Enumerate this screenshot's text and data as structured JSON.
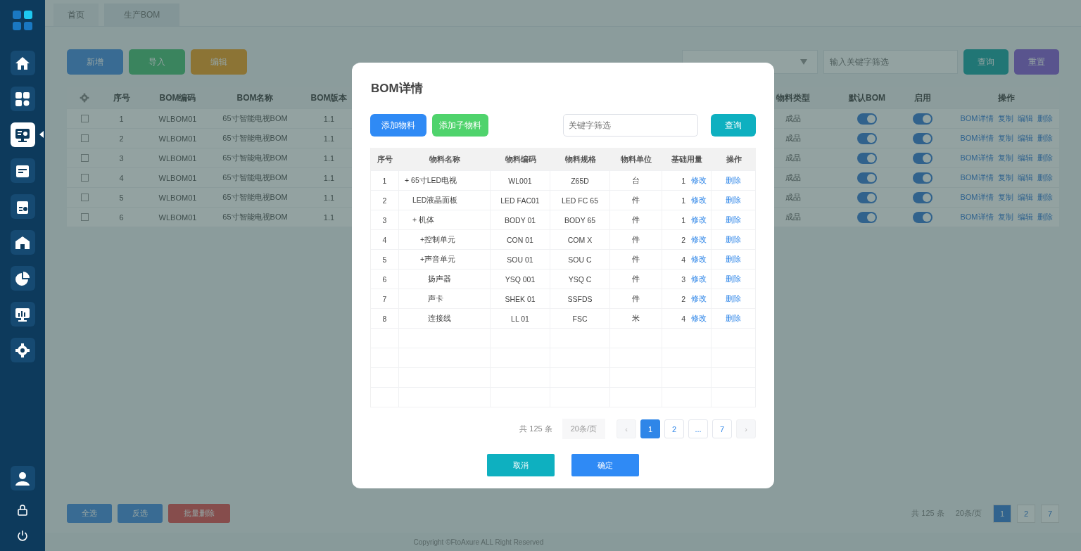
{
  "sidebar": {
    "items": [
      {
        "selected": false
      },
      {
        "selected": false
      },
      {
        "selected": true
      },
      {
        "selected": false
      },
      {
        "selected": false
      },
      {
        "selected": false
      },
      {
        "selected": false
      },
      {
        "selected": false
      },
      {
        "selected": false
      }
    ]
  },
  "tabs": [
    {
      "label": "首页",
      "selected": false
    },
    {
      "label": "生产BOM",
      "selected": true
    }
  ],
  "toolbar": {
    "buttons": [
      {
        "label": "新增",
        "kind": "blue"
      },
      {
        "label": "导入",
        "kind": "green"
      },
      {
        "label": "编辑",
        "kind": "orange"
      }
    ],
    "search_placeholder": "输入关键字筛选",
    "query": "查询",
    "reset": "重置"
  },
  "table": {
    "columns": [
      "序号",
      "BOM编码",
      "BOM名称",
      "BOM版本",
      "物料类型",
      "默认BOM",
      "启用",
      "操作"
    ],
    "rows": [
      {
        "checked": false,
        "no": "1",
        "code": "WLBOM01",
        "name": "65寸智能电视BOM",
        "version": "1.1",
        "type": "成品",
        "default_on": true,
        "enabled_on": true,
        "actions": [
          "BOM详情",
          "复制",
          "编辑",
          "删除"
        ]
      },
      {
        "checked": false,
        "no": "2",
        "code": "WLBOM01",
        "name": "65寸智能电视BOM",
        "version": "1.1",
        "type": "成品",
        "default_on": true,
        "enabled_on": true,
        "actions": [
          "BOM详情",
          "复制",
          "编辑",
          "删除"
        ]
      },
      {
        "checked": false,
        "no": "3",
        "code": "WLBOM01",
        "name": "65寸智能电视BOM",
        "version": "1.1",
        "type": "成品",
        "default_on": true,
        "enabled_on": true,
        "actions": [
          "BOM详情",
          "复制",
          "编辑",
          "删除"
        ]
      },
      {
        "checked": false,
        "no": "4",
        "code": "WLBOM01",
        "name": "65寸智能电视BOM",
        "version": "1.1",
        "type": "成品",
        "default_on": true,
        "enabled_on": true,
        "actions": [
          "BOM详情",
          "复制",
          "编辑",
          "删除"
        ]
      },
      {
        "checked": false,
        "no": "5",
        "code": "WLBOM01",
        "name": "65寸智能电视BOM",
        "version": "1.1",
        "type": "成品",
        "default_on": true,
        "enabled_on": true,
        "actions": [
          "BOM详情",
          "复制",
          "编辑",
          "删除"
        ]
      },
      {
        "checked": false,
        "no": "6",
        "code": "WLBOM01",
        "name": "65寸智能电视BOM",
        "version": "1.1",
        "type": "成品",
        "default_on": true,
        "enabled_on": true,
        "actions": [
          "BOM详情",
          "复制",
          "编辑",
          "删除"
        ]
      }
    ]
  },
  "bottom_buttons": [
    {
      "label": "全选",
      "kind": "blue"
    },
    {
      "label": "反选",
      "kind": "blue"
    },
    {
      "label": "批量删除",
      "kind": "red"
    }
  ],
  "pager": {
    "total": "共 125 条",
    "size": "20条/页",
    "pages": [
      {
        "label": "1",
        "selected": true
      },
      {
        "label": "2",
        "selected": false
      },
      {
        "label": "7",
        "selected": false
      }
    ]
  },
  "footer": "Copyright ©FtoAxure ALL Right Reserved",
  "modal": {
    "title": "BOM详情",
    "add": "添加物料",
    "add_child": "添加子物料",
    "search_placeholder": "关键字筛选",
    "query": "查询",
    "columns": [
      "序号",
      "物料名称",
      "物料编码",
      "物料规格",
      "物料单位",
      "基础用量",
      "操作"
    ],
    "rows": [
      {
        "no": "1",
        "name": "+ 65寸LED电视",
        "code": "WL001",
        "spec": "Z65D",
        "unit": "台",
        "qty": "1",
        "edit": "修改",
        "delete": "删除",
        "children": [
          {
            "no": "2",
            "name": "LED液晶面板",
            "code": "LED FAC01",
            "spec": "LED FC 65",
            "unit": "件",
            "qty": "1",
            "edit": "修改",
            "delete": "删除"
          },
          {
            "no": "3",
            "name": "+ 机体",
            "code": "BODY 01",
            "spec": "BODY 65",
            "unit": "件",
            "qty": "1",
            "edit": "修改",
            "delete": "删除",
            "children": [
              {
                "no": "4",
                "name": "+控制单元",
                "code": "CON 01",
                "spec": "COM X",
                "unit": "件",
                "qty": "2",
                "edit": "修改",
                "delete": "删除"
              },
              {
                "no": "5",
                "name": "+声音单元",
                "code": "SOU 01",
                "spec": "SOU C",
                "unit": "件",
                "qty": "4",
                "edit": "修改",
                "delete": "删除",
                "children": [
                  {
                    "no": "6",
                    "name": "扬声器",
                    "code": "YSQ 001",
                    "spec": "YSQ C",
                    "unit": "件",
                    "qty": "3",
                    "edit": "修改",
                    "delete": "删除"
                  },
                  {
                    "no": "7",
                    "name": "声卡",
                    "code": "SHEK 01",
                    "spec": "SSFDS",
                    "unit": "件",
                    "qty": "2",
                    "edit": "修改",
                    "delete": "删除"
                  },
                  {
                    "no": "8",
                    "name": "连接线",
                    "code": "LL 01",
                    "spec": "FSC",
                    "unit": "米",
                    "qty": "4",
                    "edit": "修改",
                    "delete": "删除"
                  }
                ]
              }
            ]
          }
        ]
      }
    ],
    "pager": {
      "total": "共 125 条",
      "size": "20条/页",
      "prev": "‹",
      "next": "›",
      "pages": [
        {
          "label": "1",
          "selected": true
        },
        {
          "label": "2",
          "selected": false
        },
        {
          "label": "...",
          "selected": false
        },
        {
          "label": "7",
          "selected": false
        }
      ]
    },
    "cancel": "取消",
    "confirm": "确定"
  }
}
